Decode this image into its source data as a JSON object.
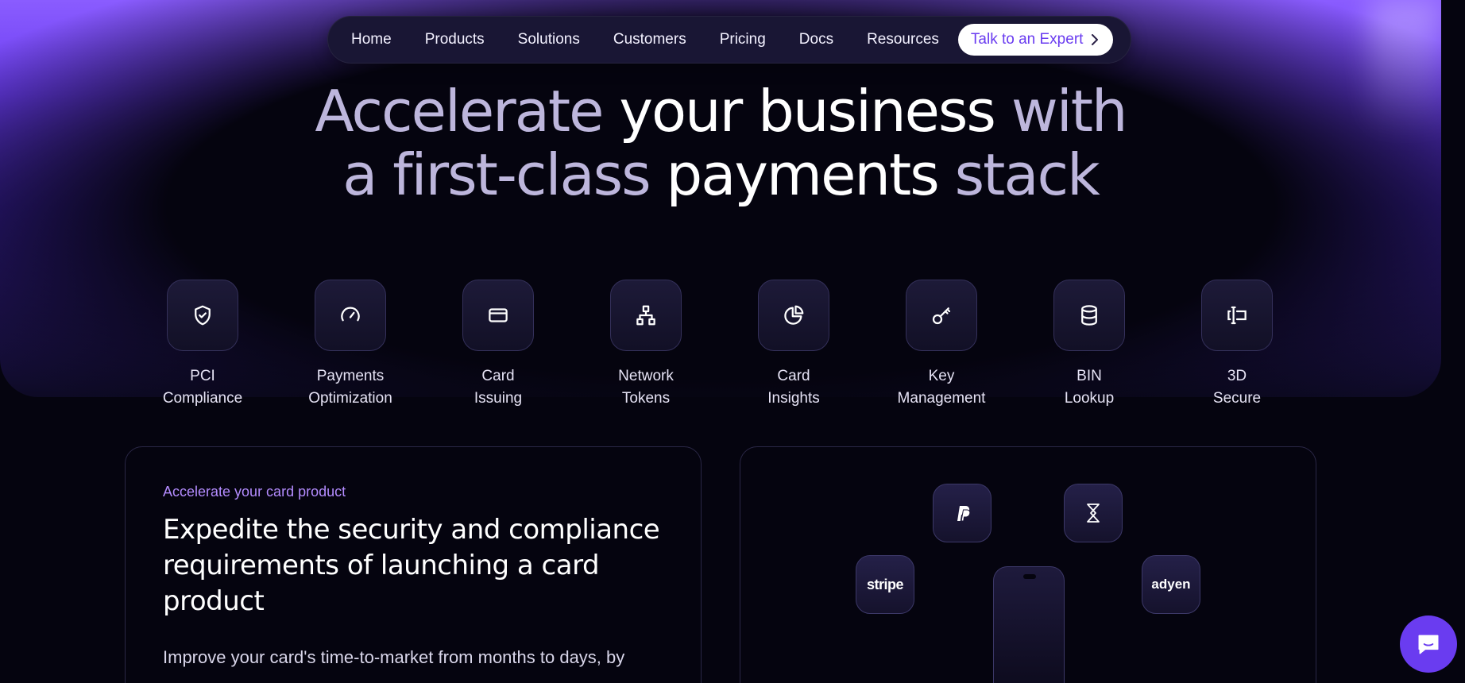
{
  "nav": {
    "items": [
      "Home",
      "Products",
      "Solutions",
      "Customers",
      "Pricing",
      "Docs",
      "Resources"
    ],
    "cta_label": "Talk to an Expert"
  },
  "hero": {
    "line1": [
      "Accelerate ",
      "your business ",
      "with"
    ],
    "line2": [
      "a ",
      "first-class ",
      "payments ",
      "stack"
    ]
  },
  "features": [
    {
      "line1": "PCI",
      "line2": "Compliance",
      "icon": "shield-check-icon"
    },
    {
      "line1": "Payments",
      "line2": "Optimization",
      "icon": "gauge-icon"
    },
    {
      "line1": "Card",
      "line2": "Issuing",
      "icon": "credit-card-icon"
    },
    {
      "line1": "Network",
      "line2": "Tokens",
      "icon": "network-icon"
    },
    {
      "line1": "Card",
      "line2": "Insights",
      "icon": "pie-chart-icon"
    },
    {
      "line1": "Key",
      "line2": "Management",
      "icon": "key-icon"
    },
    {
      "line1": "BIN",
      "line2": "Lookup",
      "icon": "database-icon"
    },
    {
      "line1": "3D",
      "line2": "Secure",
      "icon": "text-cursor-icon"
    }
  ],
  "card_product": {
    "eyebrow": "Accelerate your card product",
    "title": "Expedite the security and compliance requirements of launching a card product",
    "body": "Improve your card's time-to-market from months to days, by"
  },
  "integrations": {
    "logos": [
      "paypal-logo",
      "hourglass-logo",
      "stripe",
      "adyen"
    ],
    "stripe_label": "stripe",
    "adyen_label": "adyen"
  },
  "colors": {
    "accent": "#6a3cf0",
    "eyebrow": "#b48cff",
    "background": "#05040f"
  }
}
